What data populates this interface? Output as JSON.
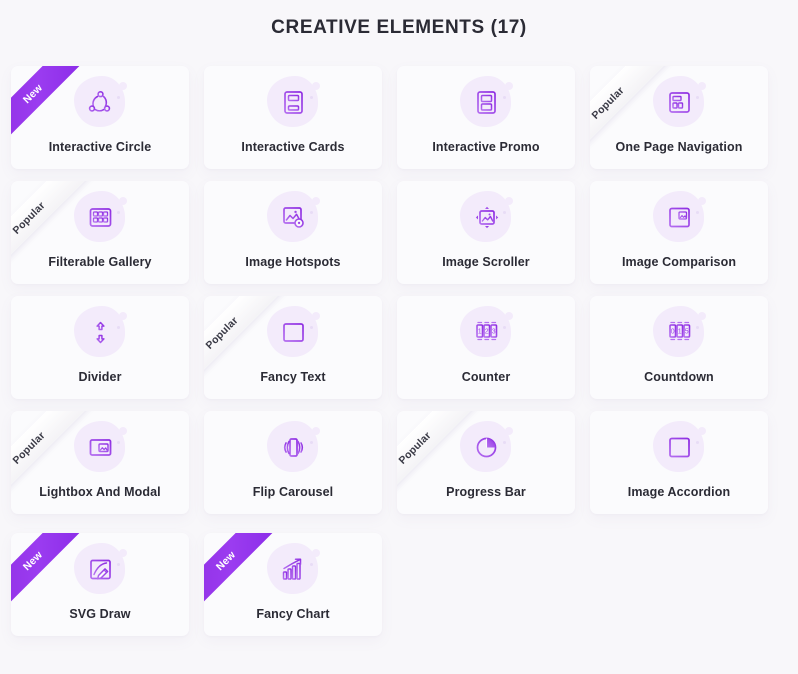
{
  "header": {
    "title": "CREATIVE ELEMENTS (17)",
    "count": 17
  },
  "badges": {
    "new_label": "New",
    "popular_label": "Popular"
  },
  "colors": {
    "page_background": "#f8f7fa",
    "card_background": "#fbfbfd",
    "accent_purple": "#8e2de2",
    "icon_blob": "#f3ebfb",
    "text_dark": "#2b2b35",
    "ribbon_popular_bg": "#ffffff"
  },
  "cards": [
    {
      "label": "Interactive Circle",
      "badge": "New",
      "icon": "interactive-circle-icon"
    },
    {
      "label": "Interactive Cards",
      "badge": null,
      "icon": "interactive-cards-icon"
    },
    {
      "label": "Interactive Promo",
      "badge": null,
      "icon": "interactive-promo-icon"
    },
    {
      "label": "One Page Navigation",
      "badge": "Popular",
      "icon": "one-page-navigation-icon"
    },
    {
      "label": "Filterable Gallery",
      "badge": "Popular",
      "icon": "filterable-gallery-icon"
    },
    {
      "label": "Image Hotspots",
      "badge": null,
      "icon": "image-hotspots-icon"
    },
    {
      "label": "Image Scroller",
      "badge": null,
      "icon": "image-scroller-icon"
    },
    {
      "label": "Image Comparison",
      "badge": null,
      "icon": "image-comparison-icon"
    },
    {
      "label": "Divider",
      "badge": null,
      "icon": "divider-icon"
    },
    {
      "label": "Fancy Text",
      "badge": "Popular",
      "icon": "fancy-text-icon"
    },
    {
      "label": "Counter",
      "badge": null,
      "icon": "counter-icon"
    },
    {
      "label": "Countdown",
      "badge": null,
      "icon": "countdown-icon"
    },
    {
      "label": "Lightbox And Modal",
      "badge": "Popular",
      "icon": "lightbox-and-modal-icon"
    },
    {
      "label": "Flip Carousel",
      "badge": null,
      "icon": "flip-carousel-icon"
    },
    {
      "label": "Progress Bar",
      "badge": "Popular",
      "icon": "progress-bar-icon"
    },
    {
      "label": "Image Accordion",
      "badge": null,
      "icon": "image-accordion-icon"
    },
    {
      "label": "SVG Draw",
      "badge": "New",
      "icon": "svg-draw-icon"
    },
    {
      "label": "Fancy Chart",
      "badge": "New",
      "icon": "fancy-chart-icon"
    }
  ]
}
